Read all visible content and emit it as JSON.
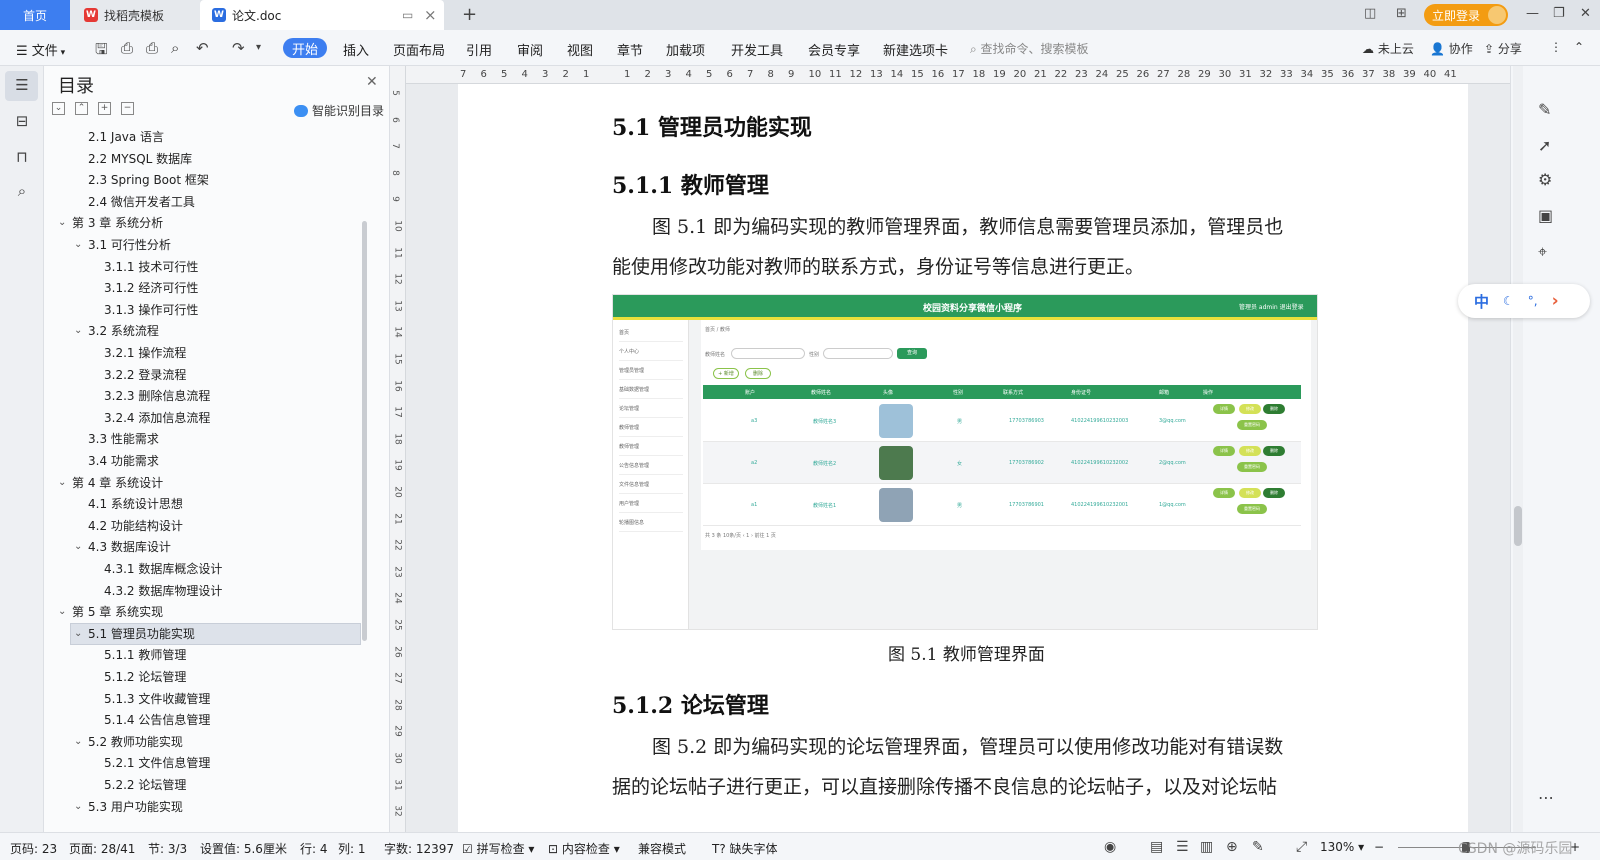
{
  "titlebar": {
    "tabs": [
      {
        "label": "首页"
      },
      {
        "label": "找稻壳模板"
      },
      {
        "label": "论文.doc"
      }
    ],
    "login_label": "立即登录"
  },
  "toolbar": {
    "file_label": "文件",
    "menus": [
      "开始",
      "插入",
      "页面布局",
      "引用",
      "审阅",
      "视图",
      "章节",
      "加载项",
      "开发工具",
      "会员专享",
      "新建选项卡"
    ],
    "search_placeholder": "查找命令、搜索模板",
    "right_items": [
      "未上云",
      "协作",
      "分享"
    ]
  },
  "toc": {
    "title": "目录",
    "ai_label": "智能识别目录",
    "items": [
      {
        "label": "2.1 Java 语言",
        "level": 2
      },
      {
        "label": "2.2 MYSQL 数据库",
        "level": 2
      },
      {
        "label": "2.3 Spring Boot 框架",
        "level": 2
      },
      {
        "label": "2.4 微信开发者工具",
        "level": 2
      },
      {
        "label": "第 3 章  系统分析",
        "level": 1,
        "expanded": true
      },
      {
        "label": "3.1  可行性分析",
        "level": 2,
        "expanded": true
      },
      {
        "label": "3.1.1  技术可行性",
        "level": 3
      },
      {
        "label": "3.1.2  经济可行性",
        "level": 3
      },
      {
        "label": "3.1.3  操作可行性",
        "level": 3
      },
      {
        "label": "3.2  系统流程",
        "level": 2,
        "expanded": true
      },
      {
        "label": "3.2.1  操作流程",
        "level": 3
      },
      {
        "label": "3.2.2  登录流程",
        "level": 3
      },
      {
        "label": "3.2.3  删除信息流程",
        "level": 3
      },
      {
        "label": "3.2.4  添加信息流程",
        "level": 3
      },
      {
        "label": "3.3  性能需求",
        "level": 2
      },
      {
        "label": "3.4  功能需求",
        "level": 2
      },
      {
        "label": "第 4 章  系统设计",
        "level": 1,
        "expanded": true
      },
      {
        "label": "4.1  系统设计思想",
        "level": 2
      },
      {
        "label": "4.2  功能结构设计",
        "level": 2
      },
      {
        "label": "4.3  数据库设计",
        "level": 2,
        "expanded": true
      },
      {
        "label": "4.3.1  数据库概念设计",
        "level": 3
      },
      {
        "label": "4.3.2  数据库物理设计",
        "level": 3
      },
      {
        "label": "第 5 章  系统实现",
        "level": 1,
        "expanded": true
      },
      {
        "label": "5.1  管理员功能实现",
        "level": 2,
        "expanded": true,
        "selected": true
      },
      {
        "label": "5.1.1  教师管理",
        "level": 3
      },
      {
        "label": "5.1.2  论坛管理",
        "level": 3
      },
      {
        "label": "5.1.3  文件收藏管理",
        "level": 3
      },
      {
        "label": "5.1.4  公告信息管理",
        "level": 3
      },
      {
        "label": "5.2  教师功能实现",
        "level": 2,
        "expanded": true
      },
      {
        "label": "5.2.1  文件信息管理",
        "level": 3
      },
      {
        "label": "5.2.2  论坛管理",
        "level": 3
      },
      {
        "label": "5.3  用户功能实现",
        "level": 2,
        "expanded": true
      }
    ]
  },
  "ruler": {
    "h_ticks": [
      "7",
      "6",
      "5",
      "4",
      "3",
      "2",
      "1",
      "",
      "1",
      "2",
      "3",
      "4",
      "5",
      "6",
      "7",
      "8",
      "9",
      "10",
      "11",
      "12",
      "13",
      "14",
      "15",
      "16",
      "17",
      "18",
      "19",
      "20",
      "21",
      "22",
      "23",
      "24",
      "25",
      "26",
      "27",
      "28",
      "29",
      "30",
      "31",
      "32",
      "33",
      "34",
      "35",
      "36",
      "37",
      "38",
      "39",
      "40",
      "41"
    ],
    "v_ticks": [
      "5",
      "6",
      "7",
      "8",
      "9",
      "10",
      "11",
      "12",
      "13",
      "14",
      "15",
      "16",
      "17",
      "18",
      "19",
      "20",
      "21",
      "22",
      "23",
      "24",
      "25",
      "26",
      "27",
      "28",
      "29",
      "30",
      "31",
      "32"
    ]
  },
  "document": {
    "h_5_1": "5.1  管理员功能实现",
    "h_5_1_1": "5.1.1  教师管理",
    "para1_line1": "图 5.1  即为编码实现的教师管理界面，教师信息需要管理员添加，管理员也",
    "para1_line2": "能使用修改功能对教师的联系方式，身份证号等信息进行更正。",
    "caption": "图 5.1  教师管理界面",
    "h_5_1_2": "5.1.2  论坛管理",
    "para2_line1": "图 5.2  即为编码实现的论坛管理界面，管理员可以使用修改功能对有错误数",
    "para2_line2": "据的论坛帖子进行更正，可以直接删除传播不良信息的论坛帖子，以及对论坛帖"
  },
  "figure": {
    "title": "校园资料分享微信小程序",
    "topbar_right": "管理员 admin   退出登录",
    "breadcrumb": "首页 / 教师",
    "search_labels": [
      "教师姓名",
      "性别"
    ],
    "search_button": "查询",
    "add_button": "+ 新增",
    "delete_button": "删除",
    "sidebar": [
      "首页",
      "个人中心",
      "管理员管理",
      "基础数据管理",
      "论坛管理",
      "教师管理",
      "教师管理",
      "公告信息管理",
      "文件信息管理",
      "用户管理",
      "轮播图信息"
    ],
    "columns": [
      "",
      "账户",
      "教师姓名",
      "头像",
      "性别",
      "联系方式",
      "身份证号",
      "邮箱",
      "操作"
    ],
    "rows": [
      {
        "account": "a3",
        "name": "教师姓名3",
        "gender": "男",
        "phone": "17703786903",
        "id": "410224199610232003",
        "email": "3@qq.com"
      },
      {
        "account": "a2",
        "name": "教师姓名2",
        "gender": "女",
        "phone": "17703786902",
        "id": "410224199610232002",
        "email": "2@qq.com"
      },
      {
        "account": "a1",
        "name": "教师姓名1",
        "gender": "男",
        "phone": "17703786901",
        "id": "410224199610232001",
        "email": "1@qq.com"
      }
    ],
    "op_labels": [
      "详情",
      "修改",
      "删除",
      "重置密码"
    ],
    "pagination": "共 3 条   10条/页   ‹  1  ›   前往  1  页"
  },
  "ime": {
    "zh": "中",
    "dot": "°,",
    "arrow": "›"
  },
  "status": {
    "page_code": "页码: 23",
    "page": "页面: 28/41",
    "section": "节: 3/3",
    "setting": "设置值: 5.6厘米",
    "row": "行: 4",
    "col": "列: 1",
    "words": "字数: 12397",
    "spell": "拼写检查",
    "content_check": "内容检查",
    "compat": "兼容模式",
    "missing_font": "缺失字体",
    "zoom": "130%",
    "watermark": "CSDN @源码乐园"
  },
  "colors": {
    "accent": "#3d7ef0",
    "login": "#f39c12",
    "figure_green": "#2b9a5b",
    "figure_yellow": "#e8e03c"
  }
}
